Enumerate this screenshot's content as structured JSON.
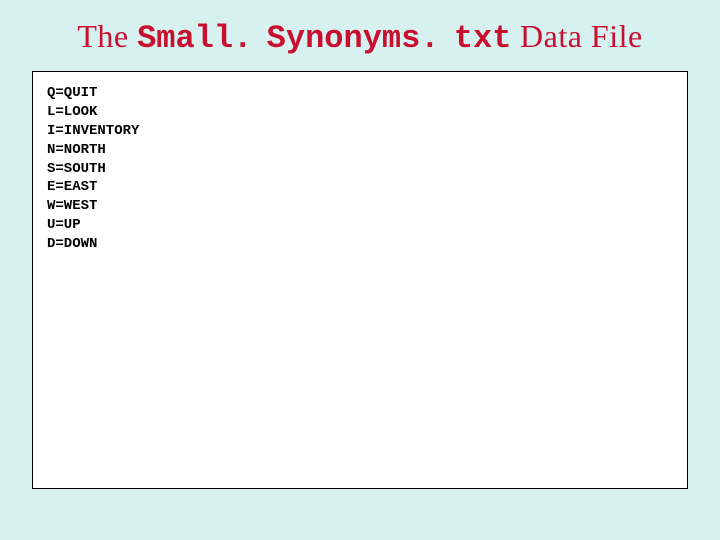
{
  "title": {
    "prefix": "The ",
    "filename_parts": [
      "Small.",
      "Synonyms.",
      "txt"
    ],
    "suffix": " Data File"
  },
  "file_lines": [
    "Q=QUIT",
    "L=LOOK",
    "I=INVENTORY",
    "N=NORTH",
    "S=SOUTH",
    "E=EAST",
    "W=WEST",
    "U=UP",
    "D=DOWN"
  ]
}
